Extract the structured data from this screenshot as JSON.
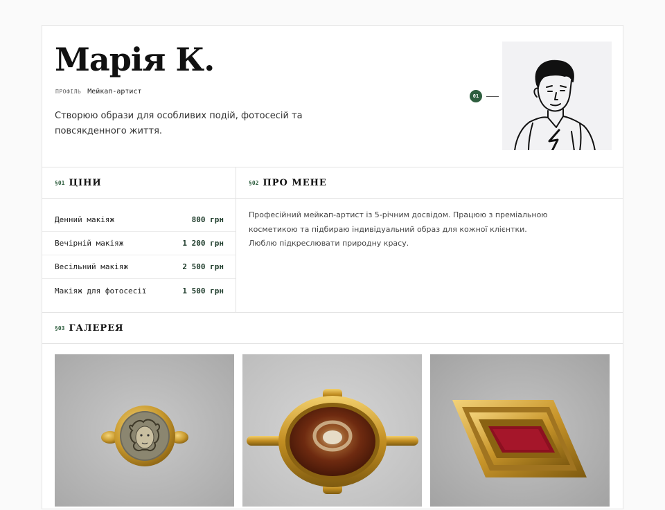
{
  "profile": {
    "name": "Марія К.",
    "role_kicker": "ПРОФІЛЬ",
    "role": "Мейкап-артист",
    "tagline": "Створюю образи для особливих подій, фотосесій та повсякденного життя.",
    "photo_marker": "01"
  },
  "sections": {
    "prices": {
      "num": "§01",
      "title": "ЦІНИ"
    },
    "about": {
      "num": "§02",
      "title": "ПРО МЕНЕ"
    },
    "gallery": {
      "num": "§03",
      "title": "ГАЛЕРЕЯ"
    }
  },
  "prices": [
    {
      "label": "Денний макіяж",
      "value": "800 грн"
    },
    {
      "label": "Вечірній макіяж",
      "value": "1 200 грн"
    },
    {
      "label": "Весільний макіяж",
      "value": "2 500 грн"
    },
    {
      "label": "Макіяж для фотосесії",
      "value": "1 500 грн"
    }
  ],
  "about": {
    "text": "Професійний мейкап-артист із 5-річним досвідом. Працюю з преміальною косметикою та підбираю індивідуальний образ для кожної клієнтки. Люблю підкреслювати природну красу."
  },
  "gallery": [
    {
      "icon": "medusa-brooch-image"
    },
    {
      "icon": "eye-agate-brooch-image"
    },
    {
      "icon": "rhombus-garnet-brooch-image"
    }
  ],
  "colors": {
    "accent": "#2e5e3e",
    "price": "#1d3b2a",
    "border": "#e3e3e3"
  }
}
